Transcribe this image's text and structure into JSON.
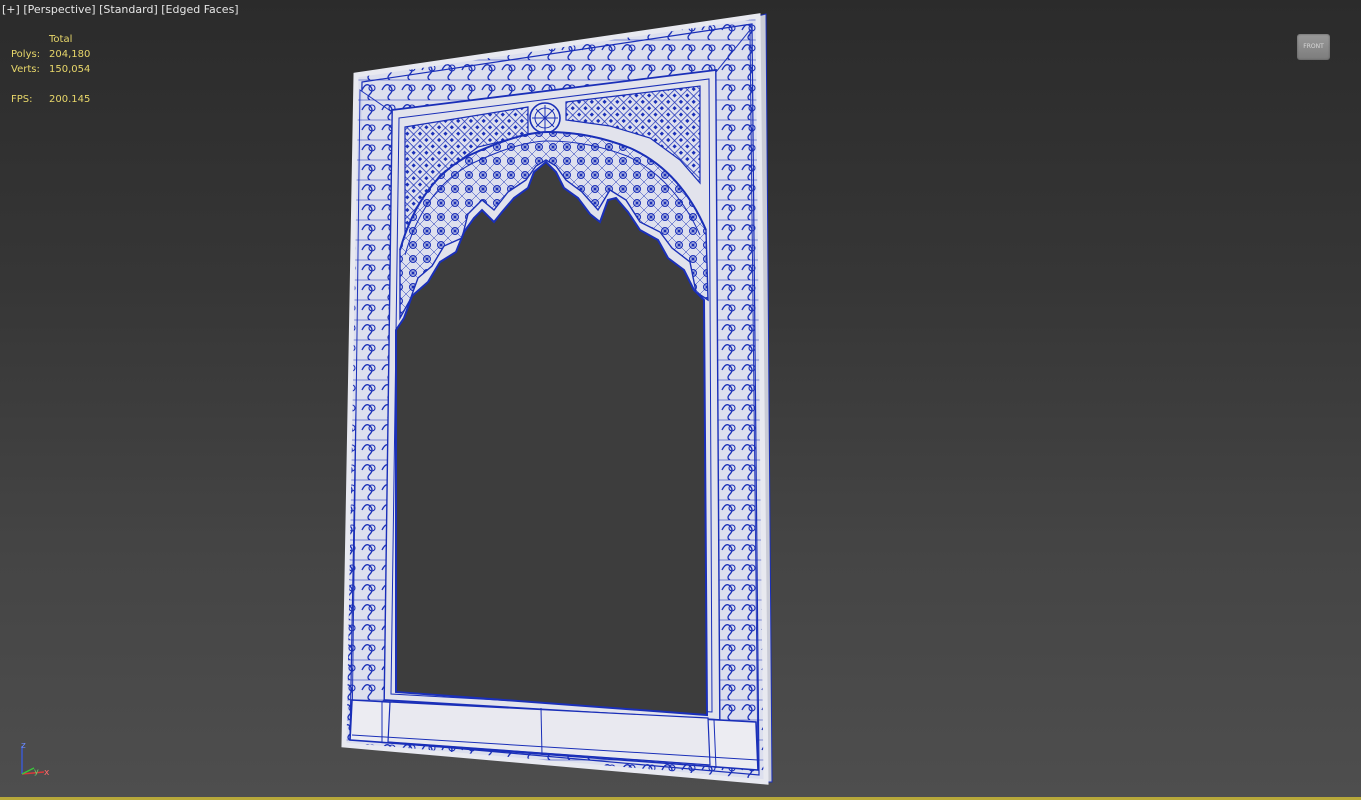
{
  "viewport": {
    "label_plus": "[+]",
    "label_view": "[Perspective]",
    "label_shading": "[Standard]",
    "label_mode": "[Edged Faces]"
  },
  "stats": {
    "header": "Total",
    "polys_label": "Polys:",
    "polys_value": "204,180",
    "verts_label": "Verts:",
    "verts_value": "150,054",
    "fps_label": "FPS:",
    "fps_value": "200.145"
  },
  "viewcube": {
    "face_label": "FRONT"
  },
  "axis": {
    "z": "z",
    "y": "y",
    "x": "x"
  },
  "colors": {
    "wire": "#1a2fb8",
    "panel": "#e4e4ea",
    "stats_text": "#e8d76a",
    "label_text": "#e6e6e6"
  }
}
